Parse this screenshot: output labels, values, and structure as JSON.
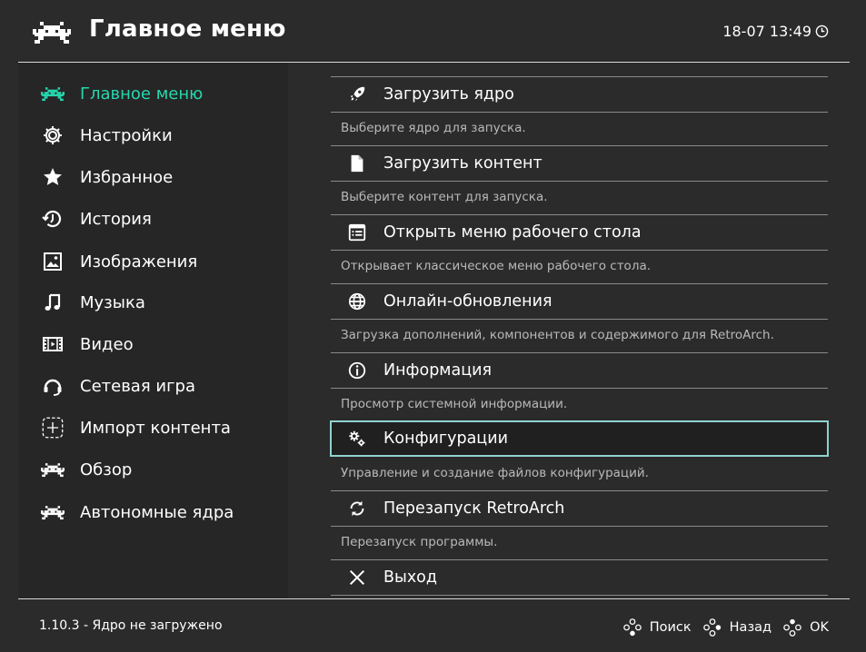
{
  "header": {
    "title": "Главное меню",
    "clock": "18-07 13:49"
  },
  "sidebar": {
    "items": [
      {
        "label": "Главное меню",
        "icon": "invader-icon",
        "active": true
      },
      {
        "label": "Настройки",
        "icon": "gear-icon"
      },
      {
        "label": "Избранное",
        "icon": "star-icon"
      },
      {
        "label": "История",
        "icon": "history-icon"
      },
      {
        "label": "Изображения",
        "icon": "image-icon"
      },
      {
        "label": "Музыка",
        "icon": "music-note-icon"
      },
      {
        "label": "Видео",
        "icon": "film-icon"
      },
      {
        "label": "Сетевая игра",
        "icon": "headset-icon"
      },
      {
        "label": "Импорт контента",
        "icon": "add-icon"
      },
      {
        "label": "Обзор",
        "icon": "invader-icon"
      },
      {
        "label": "Автономные ядра",
        "icon": "invader-icon"
      }
    ]
  },
  "menu": {
    "entries": [
      {
        "label": "Загрузить ядро",
        "description": "Выберите ядро для запуска.",
        "icon": "rocket-icon"
      },
      {
        "label": "Загрузить контент",
        "description": "Выберите контент для запуска.",
        "icon": "file-icon"
      },
      {
        "label": "Открыть меню рабочего стола",
        "description": "Открывает классическое меню рабочего стола.",
        "icon": "window-icon"
      },
      {
        "label": "Онлайн-обновления",
        "description": "Загрузка дополнений, компонентов и содержимого для RetroArch.",
        "icon": "globe-icon"
      },
      {
        "label": "Информация",
        "description": "Просмотр системной информации.",
        "icon": "info-icon"
      },
      {
        "label": "Конфигурации",
        "description": "Управление и создание файлов конфигураций.",
        "icon": "gears-icon",
        "selected": true
      },
      {
        "label": "Перезапуск RetroArch",
        "description": "Перезапуск программы.",
        "icon": "restart-icon"
      },
      {
        "label": "Выход",
        "description": "",
        "icon": "close-icon"
      }
    ]
  },
  "footer": {
    "status": "1.10.3 - Ядро не загружено",
    "search_label": "Поиск",
    "back_label": "Назад",
    "ok_label": "OK"
  },
  "colors": {
    "accent": "#26d7ae",
    "selection_border": "#8fd3d0",
    "background": "#2b2b2b",
    "sidebar": "#262626"
  }
}
